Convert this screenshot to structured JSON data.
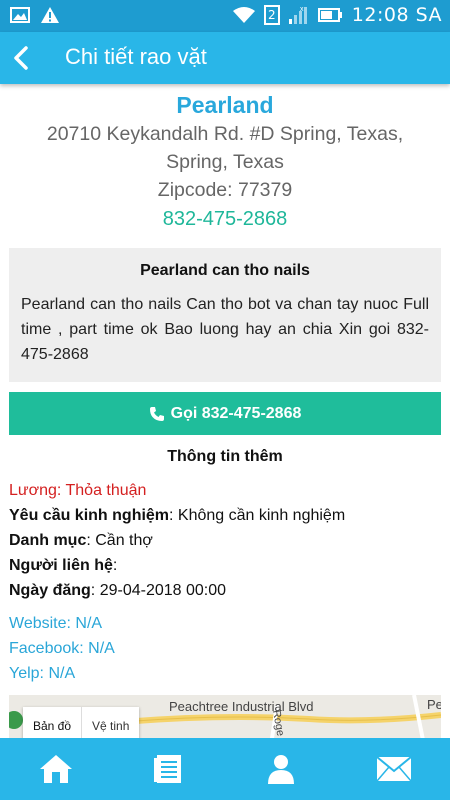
{
  "status_bar": {
    "time": "12:08 SA",
    "notification_badge": "2",
    "icons": [
      "image-icon",
      "warning-icon",
      "wifi-icon",
      "signal-icon",
      "battery-icon"
    ]
  },
  "app_bar": {
    "title": "Chi tiết rao vặt"
  },
  "listing": {
    "name": "Pearland",
    "address": "20710 Keykandalh Rd. #D Spring, Texas, Spring, Texas",
    "zipcode": "Zipcode: 77379",
    "phone": "832-475-2868",
    "title": "Pearland can tho nails",
    "description": "Pearland can tho nails  Can tho bot va chan tay nuoc  Full time , part time ok Bao luong hay an chia Xin goi  832-475-2868",
    "call_button_label": "Gọi 832-475-2868"
  },
  "more_info": {
    "heading": "Thông tin thêm",
    "salary": "Lương: Thỏa thuận",
    "experience_label": "Yêu cầu kinh nghiệm",
    "experience_value": ": Không cần kinh nghiệm",
    "category_label": "Danh mục",
    "category_value": ": Cần thợ",
    "contact_label": "Người liên hệ",
    "contact_value": ":",
    "date_label": "Ngày đăng",
    "date_value": ": 29-04-2018 00:00",
    "website": "Website: N/A",
    "facebook": "Facebook: N/A",
    "yelp": "Yelp: N/A"
  },
  "map": {
    "tab_map": "Bản đồ",
    "tab_satellite": "Vệ tinh",
    "road_1": "Peachtree Industrial Blvd",
    "road_2": "Pe",
    "road_3": "Roge"
  },
  "bottom_nav": {
    "items": [
      "home-icon",
      "list-icon",
      "user-icon",
      "mail-icon"
    ]
  },
  "colors": {
    "status_bar": "#1e9cd0",
    "app_bar": "#29b6e8",
    "accent_blue": "#29a8dc",
    "accent_green": "#1fbd9b",
    "salary_red": "#d42020"
  }
}
